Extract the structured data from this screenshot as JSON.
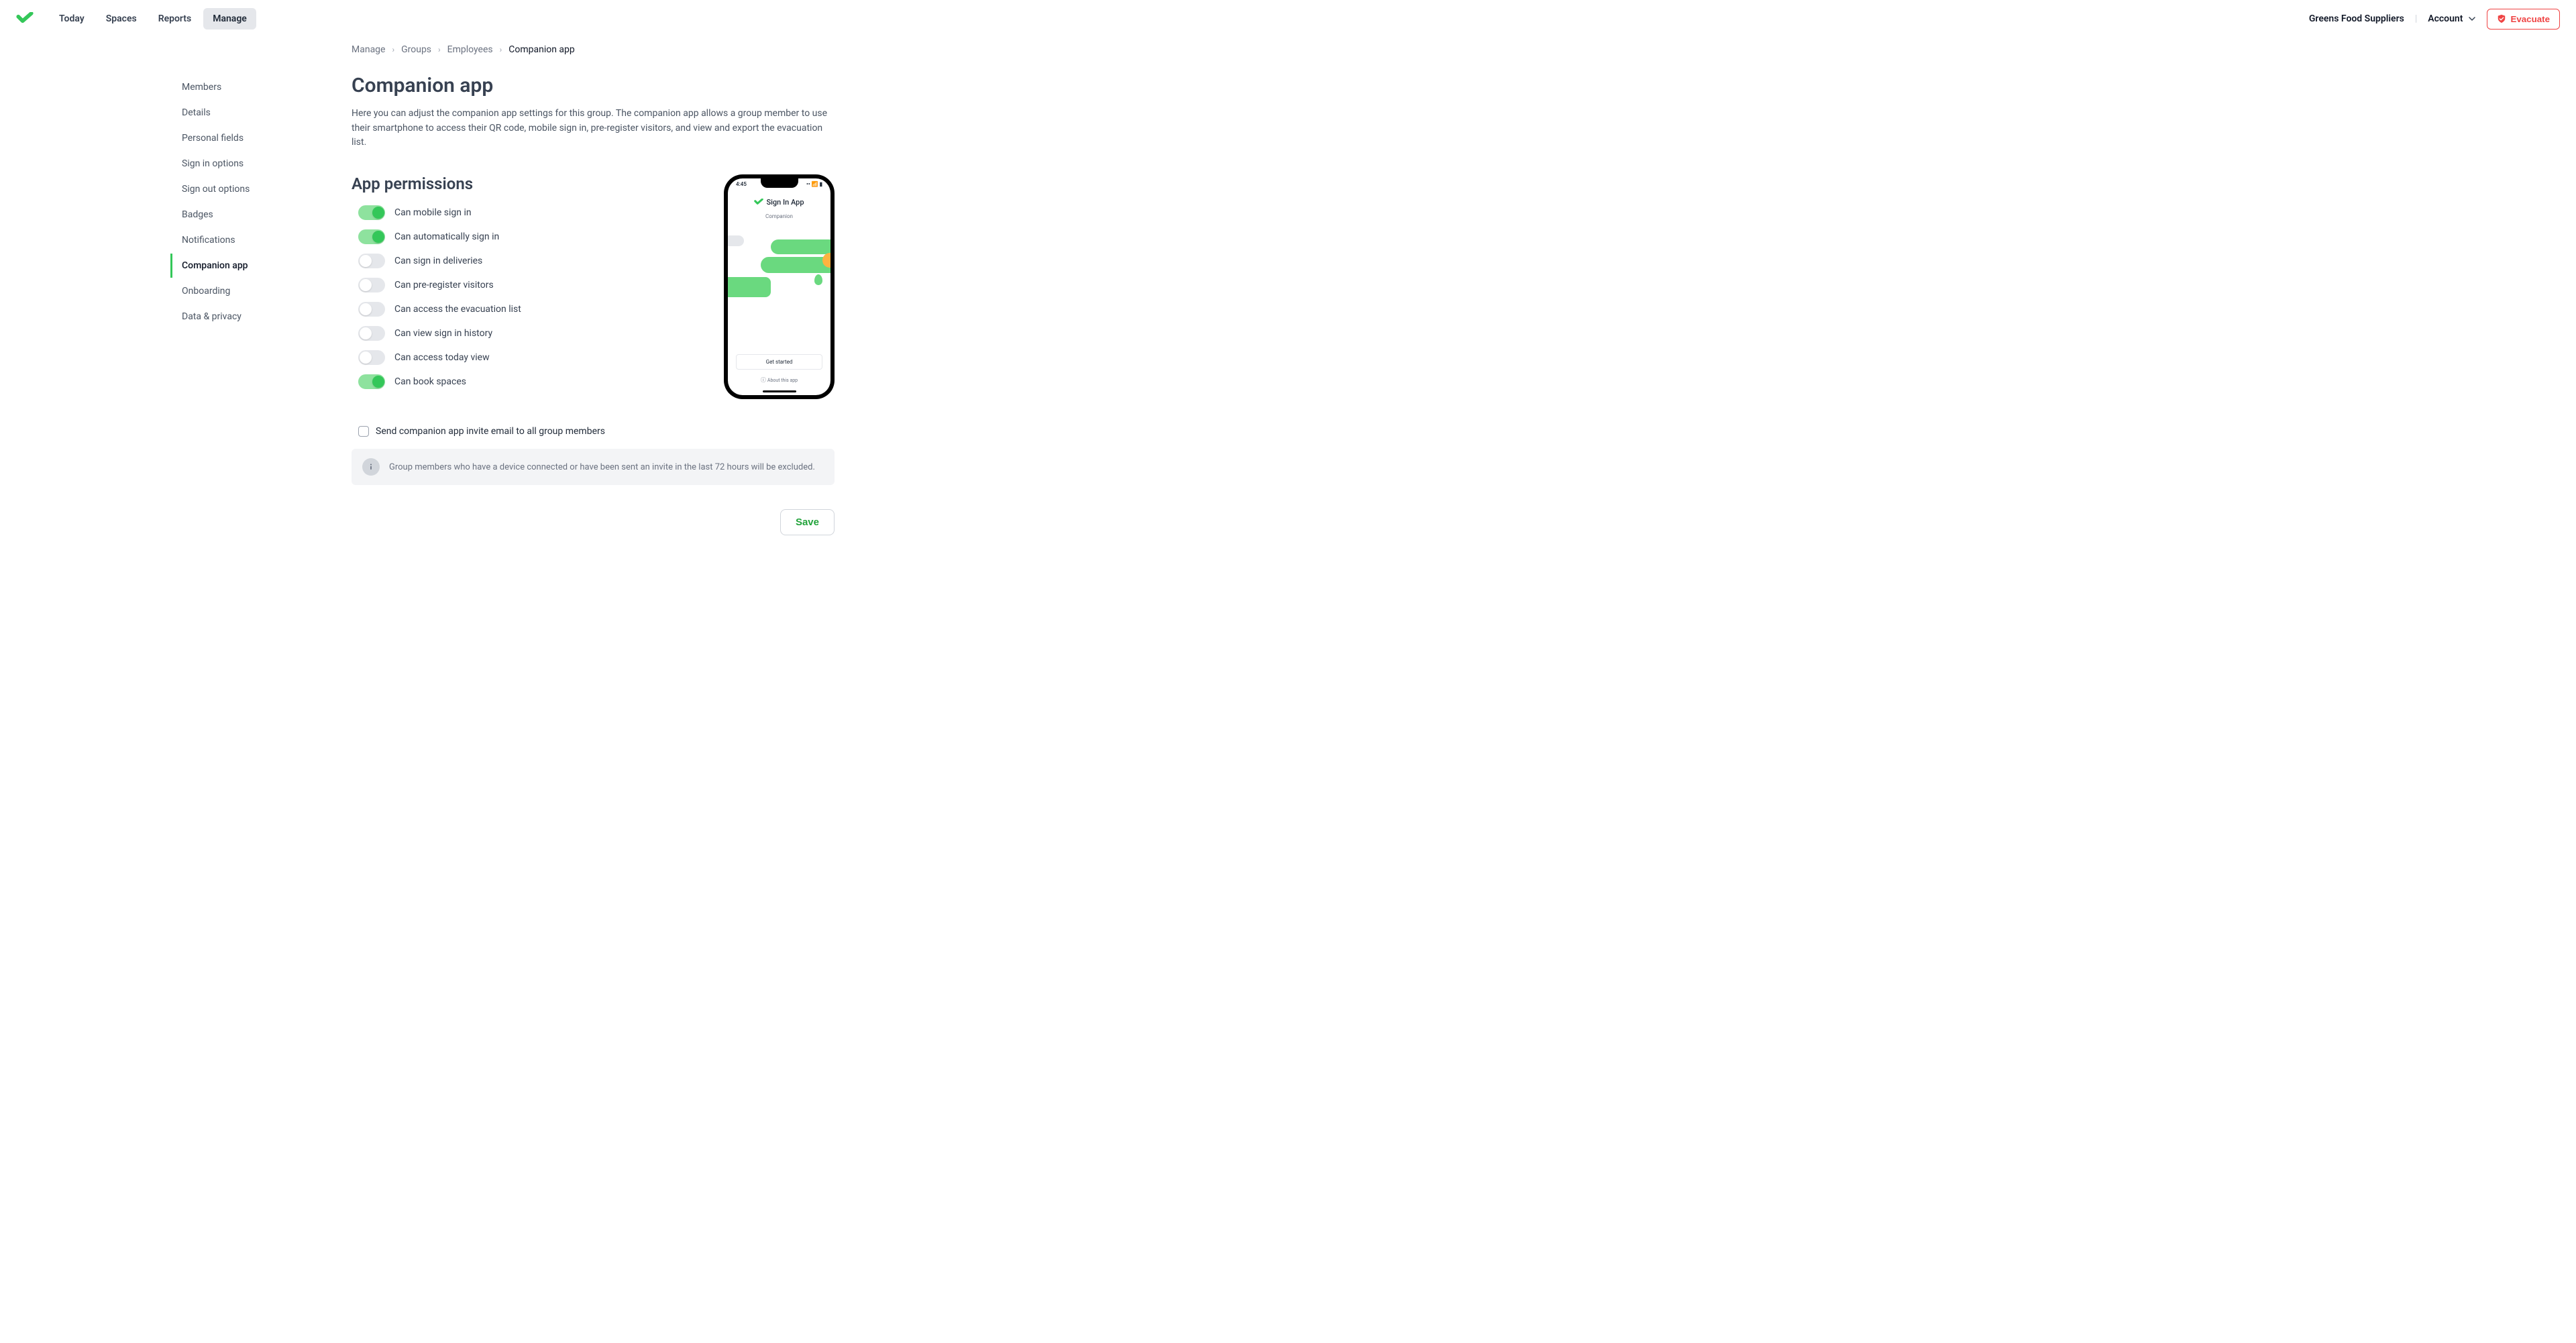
{
  "header": {
    "nav": [
      "Today",
      "Spaces",
      "Reports",
      "Manage"
    ],
    "active_nav": "Manage",
    "org": "Greens Food Suppliers",
    "account_label": "Account",
    "evacuate_label": "Evacuate"
  },
  "breadcrumb": [
    "Manage",
    "Groups",
    "Employees",
    "Companion app"
  ],
  "sidebar": {
    "items": [
      "Members",
      "Details",
      "Personal fields",
      "Sign in options",
      "Sign out options",
      "Badges",
      "Notifications",
      "Companion app",
      "Onboarding",
      "Data & privacy"
    ],
    "active": "Companion app"
  },
  "page": {
    "title": "Companion app",
    "description": "Here you can adjust the companion app settings for this group. The companion app allows a group member to use their smartphone to access their QR code, mobile sign in, pre-register visitors, and view and export the evacuation list."
  },
  "permissions": {
    "title": "App permissions",
    "items": [
      {
        "label": "Can mobile sign in",
        "on": true
      },
      {
        "label": "Can automatically sign in",
        "on": true
      },
      {
        "label": "Can sign in deliveries",
        "on": false
      },
      {
        "label": "Can pre-register visitors",
        "on": false
      },
      {
        "label": "Can access the evacuation list",
        "on": false
      },
      {
        "label": "Can view sign in history",
        "on": false
      },
      {
        "label": "Can access today view",
        "on": false
      },
      {
        "label": "Can book spaces",
        "on": true
      }
    ]
  },
  "phone": {
    "time": "4:45",
    "brand": "Sign In App",
    "subtitle": "Companion",
    "get_started": "Get started",
    "about": "About this app"
  },
  "invite": {
    "label": "Send companion app invite email to all group members",
    "checked": false,
    "info": "Group members who have a device connected or have been sent an invite in the last 72 hours will be excluded."
  },
  "save_label": "Save"
}
